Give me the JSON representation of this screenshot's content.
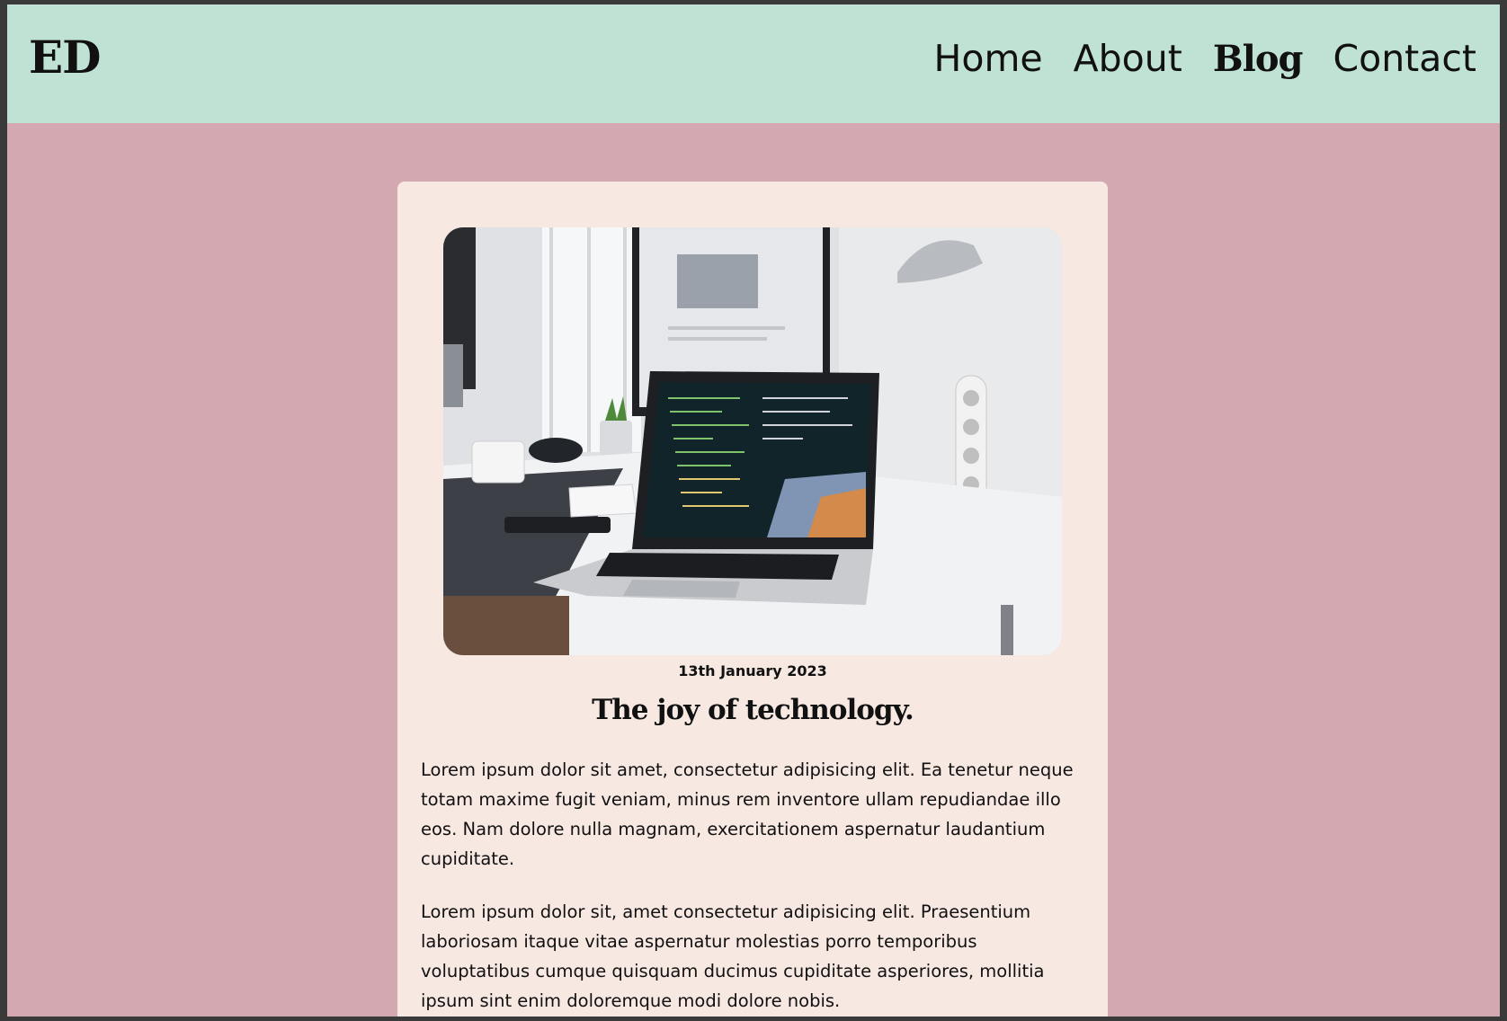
{
  "header": {
    "logo": "ED",
    "nav": [
      {
        "label": "Home",
        "active": false
      },
      {
        "label": "About",
        "active": false
      },
      {
        "label": "Blog",
        "active": true
      },
      {
        "label": "Contact",
        "active": false
      }
    ]
  },
  "post": {
    "date": "13th January 2023",
    "title": "The joy of technology.",
    "paragraphs": [
      "Lorem ipsum dolor sit amet, consectetur adipisicing elit. Ea tenetur neque totam maxime fugit veniam, minus rem inventore ullam repudiandae illo eos. Nam dolore nulla magnam, exercitationem aspernatur laudantium cupiditate.",
      "Lorem ipsum dolor sit, amet consectetur adipisicing elit. Praesentium laboriosam itaque vitae aspernatur molestias porro temporibus voluptatibus cumque quisquam ducimus cupiditate asperiores, mollitia ipsum sint enim doloremque modi dolore nobis."
    ]
  },
  "colors": {
    "header_bg": "#c0e2d4",
    "page_bg": "#d3a8b0",
    "card_bg": "#f7e8e2",
    "text": "#111111"
  }
}
